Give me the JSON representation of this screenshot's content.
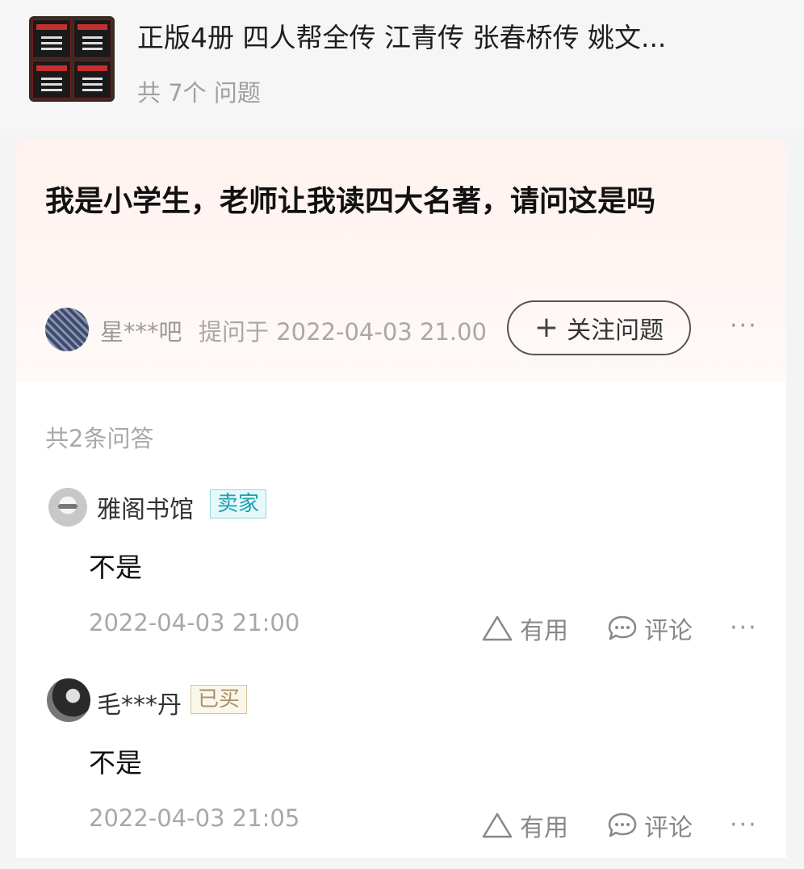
{
  "product": {
    "title": "正版4册 四人帮全传 江青传 张春桥传 姚文...",
    "question_count": "共 7个 问题"
  },
  "question": {
    "text": "我是小学生，老师让我读四大名著，请问这是吗",
    "asker": "星***吧",
    "asked_at": "提问于 2022-04-03 21.00",
    "follow_label": "关注问题",
    "more": "···"
  },
  "answers_panel": {
    "count_label": "共2条问答",
    "answers": [
      {
        "name": "雅阁书馆",
        "badge": "卖家",
        "text": "不是",
        "time": "2022-04-03 21:00",
        "useful_label": "有用",
        "comment_label": "评论",
        "more": "···"
      },
      {
        "name": "毛***丹",
        "badge": "已买",
        "text": "不是",
        "time": "2022-04-03 21:05",
        "useful_label": "有用",
        "comment_label": "评论",
        "more": "···"
      }
    ]
  },
  "colors": {
    "seller_badge": "#1a9fb0",
    "bought_badge": "#a79069",
    "card_tint": "#fff2ef"
  }
}
